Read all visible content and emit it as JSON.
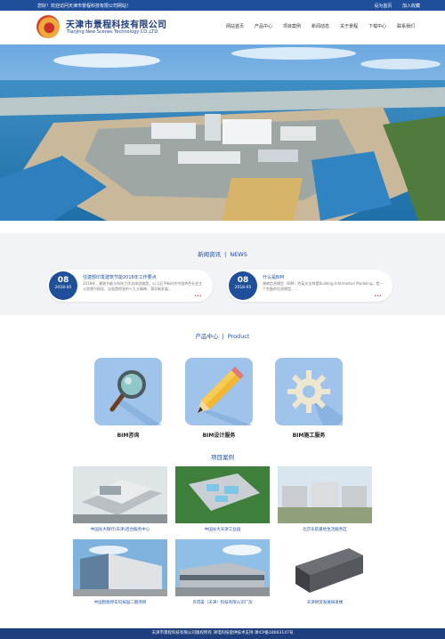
{
  "topbar": {
    "welcome": "您好！欢迎访问天津市景程科技有限公司网站！",
    "set_home": "设为首页",
    "add_favorite": "加入收藏"
  },
  "header": {
    "company_cn": "天津市景程科技有限公司",
    "company_en": "Tianjing New Scenes Technology CO.,LTD."
  },
  "nav": {
    "items": [
      "网站首页",
      "产品中心",
      "项目案例",
      "新闻动态",
      "关于景程",
      "下载中心",
      "联系我们"
    ]
  },
  "news": {
    "title_cn": "新闻资讯",
    "title_en": "NEWS",
    "items": [
      {
        "day": "08",
        "ym": "2018-05",
        "title": "住建部印发建筑节能2018年工作要点",
        "desc": "2018年，建筑节能与科技工作总体思路是，以习近平新时代中国特色社会主义思想为指导，全面贯彻党的十九大精神，落实新发展...",
        "more": "•••"
      },
      {
        "day": "08",
        "ym": "2018-05",
        "title": "什么是BIM",
        "desc": "建筑信息模型（BIM）的英文全称是Building Information Modeling，是一个完备的信息模型，...",
        "more": "•••"
      }
    ]
  },
  "products": {
    "title_cn": "产品中心",
    "title_en": "Product",
    "items": [
      {
        "label": "BIM咨询",
        "icon": "magnifier-icon"
      },
      {
        "label": "BIM设计服务",
        "icon": "pencil-icon"
      },
      {
        "label": "BIM施工服务",
        "icon": "gear-icon"
      }
    ]
  },
  "cases": {
    "title": "项目案例",
    "items": [
      {
        "caption": "中国光大银行(天津)后台服务中心"
      },
      {
        "caption": "中国光大天津工业园"
      },
      {
        "caption": "北京东航嘉地生活服务区"
      },
      {
        "caption": "中国智能停车科技园二期项目"
      },
      {
        "caption": "贝得美（天津）科技有限公司厂房"
      },
      {
        "caption": "天津财贸发展研发楼"
      }
    ]
  },
  "footer": {
    "text": "天津市景程科技有限公司版权所有 津电科技提供技术支持 津ICP备18003147号"
  },
  "colors": {
    "primary": "#1f4f9b",
    "dark_blue": "#1f3e7e",
    "product_tile": "#9fc3ea",
    "news_bg": "#f1f3f7"
  }
}
